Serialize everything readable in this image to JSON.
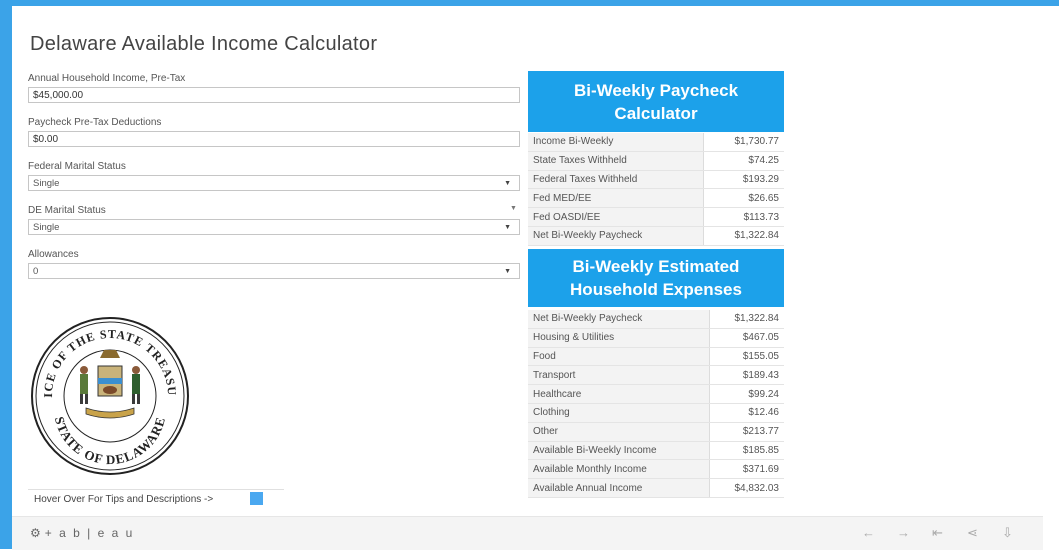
{
  "page": {
    "title": "Delaware Available Income Calculator"
  },
  "inputs": {
    "income_label": "Annual Household Income, Pre-Tax",
    "income_value": "$45,000.00",
    "deductions_label": "Paycheck Pre-Tax Deductions",
    "deductions_value": "$0.00",
    "federal_label": "Federal Marital Status",
    "federal_value": "Single",
    "de_label": "DE Marital Status",
    "de_value": "Single",
    "allowances_label": "Allowances",
    "allowances_value": "0"
  },
  "paycheck": {
    "header_line1": "Bi-Weekly Paycheck",
    "header_line2": "Calculator",
    "rows": [
      {
        "label": "Income Bi-Weekly",
        "value": "$1,730.77"
      },
      {
        "label": "State Taxes Withheld",
        "value": "$74.25"
      },
      {
        "label": "Federal Taxes Withheld",
        "value": "$193.29"
      },
      {
        "label": "Fed MED/EE",
        "value": "$26.65"
      },
      {
        "label": "Fed OASDI/EE",
        "value": "$113.73"
      },
      {
        "label": "Net Bi-Weekly Paycheck",
        "value": "$1,322.84"
      }
    ]
  },
  "expenses": {
    "header_line1": "Bi-Weekly Estimated",
    "header_line2": "Household Expenses",
    "rows": [
      {
        "label": "Net Bi-Weekly Paycheck",
        "value": "$1,322.84"
      },
      {
        "label": "Housing & Utilities",
        "value": "$467.05"
      },
      {
        "label": "Food",
        "value": "$155.05"
      },
      {
        "label": "Transport",
        "value": "$189.43"
      },
      {
        "label": "Healthcare",
        "value": "$99.24"
      },
      {
        "label": "Clothing",
        "value": "$12.46"
      },
      {
        "label": "Other",
        "value": "$213.77"
      },
      {
        "label": "Available Bi-Weekly Income",
        "value": "$185.85"
      },
      {
        "label": "Available Monthly Income",
        "value": "$371.69"
      },
      {
        "label": "Available Annual Income",
        "value": "$4,832.03"
      }
    ]
  },
  "seal": {
    "top_text": "OFFICE OF THE STATE TREASURER",
    "bottom_text": "STATE OF DELAWARE"
  },
  "footer": {
    "hover_tip": "Hover Over For Tips and Descriptions ->",
    "logo_text": "+ a b | e a u"
  },
  "icons": {
    "arrow": "chevron-down-icon",
    "toolbar": [
      "undo-icon",
      "redo-icon",
      "revert-icon",
      "share-icon",
      "download-icon"
    ]
  },
  "colors": {
    "accent": "#1ca1ea",
    "frame": "#3ba3e8"
  }
}
